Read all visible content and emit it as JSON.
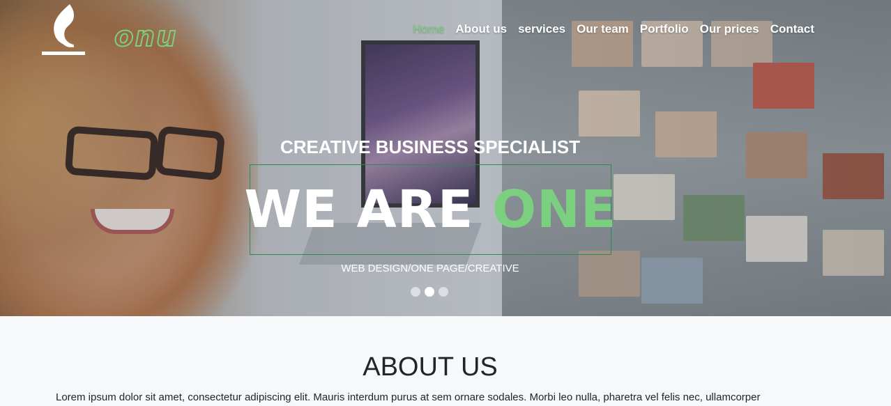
{
  "brand": {
    "logo_text": "onu"
  },
  "nav": {
    "items": [
      {
        "label": "Home",
        "active": true
      },
      {
        "label": "About us",
        "active": false
      },
      {
        "label": "services",
        "active": false
      },
      {
        "label": "Our team",
        "active": false
      },
      {
        "label": "Portfolio",
        "active": false
      },
      {
        "label": "Our prices",
        "active": false
      },
      {
        "label": "Contact",
        "active": false
      }
    ]
  },
  "hero": {
    "kicker": "CREATIVE BUSINESS SPECIALIST",
    "title_main": "WE ARE",
    "title_accent": "ONE",
    "tagline": "WEB DESIGN/ONE PAGE/CREATIVE",
    "slides_count": 3,
    "active_slide": 2
  },
  "about": {
    "title": "ABOUT US",
    "text": "Lorem ipsum dolor sit amet, consectetur adipiscing elit. Mauris interdum purus at sem ornare sodales. Morbi leo nulla, pharetra vel felis nec, ullamcorper"
  },
  "colors": {
    "accent": "#7bd07f",
    "title_border": "#2d8a4e",
    "text": "#212529",
    "section_bg": "#f7f8fa"
  }
}
